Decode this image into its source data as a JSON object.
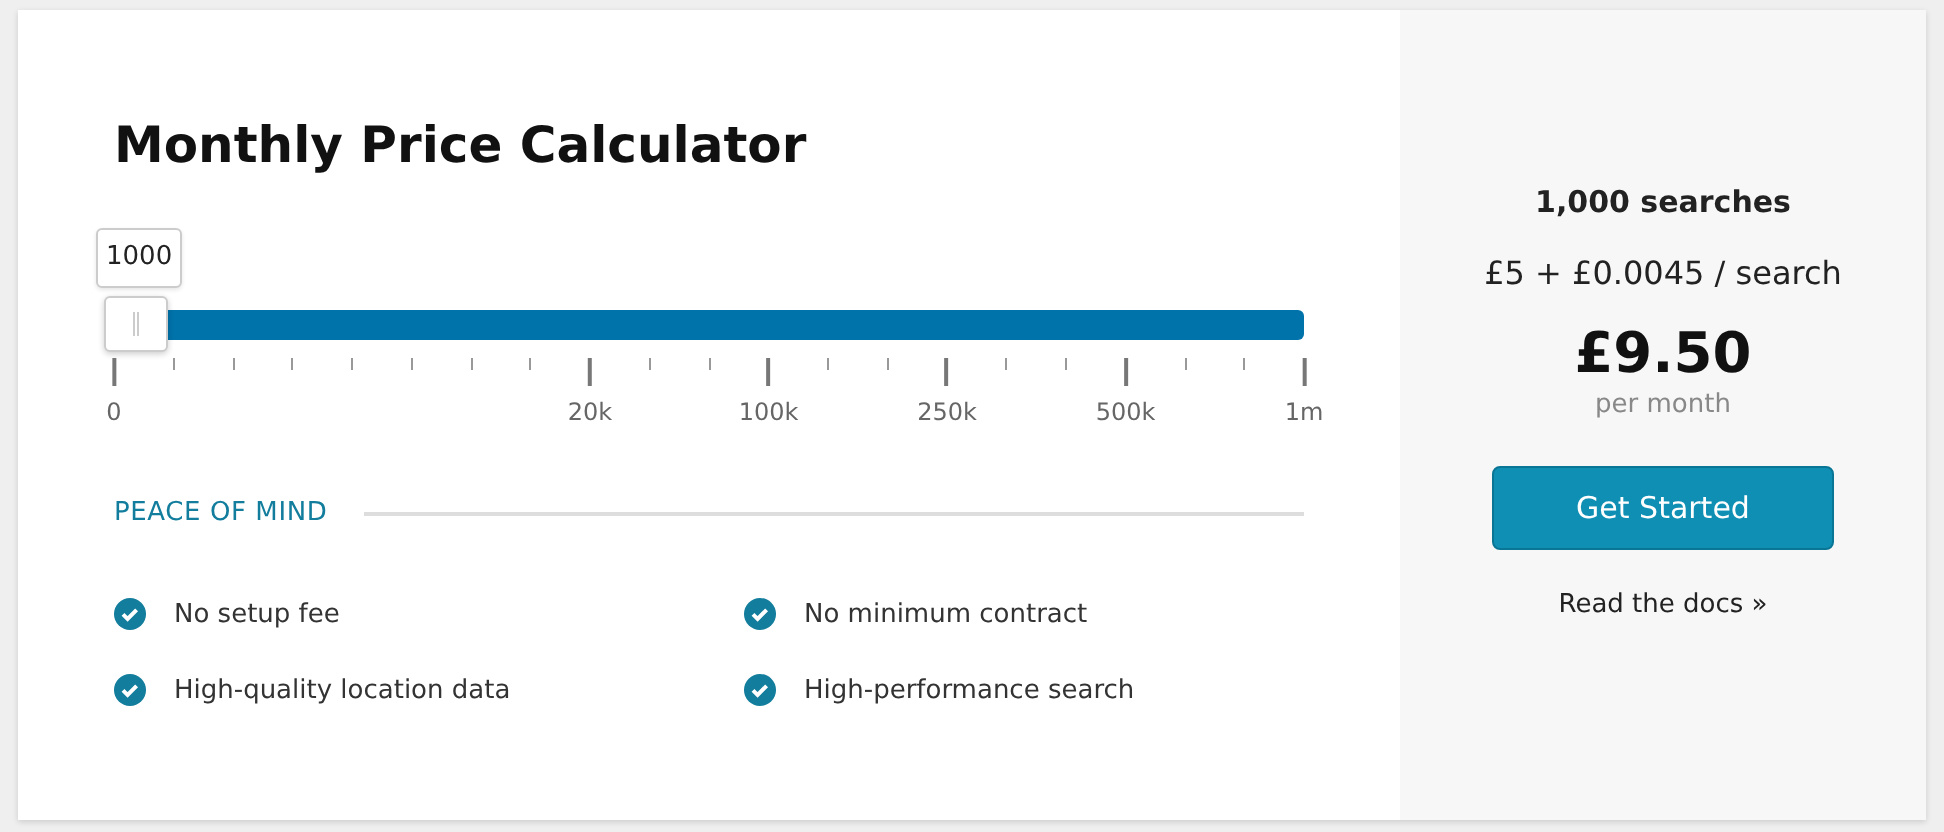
{
  "title": "Monthly Price Calculator",
  "slider": {
    "value": "1000",
    "level": 0.0,
    "ticks": [
      {
        "kind": "major",
        "label": "0"
      },
      {
        "kind": "minor"
      },
      {
        "kind": "minor"
      },
      {
        "kind": "minor"
      },
      {
        "kind": "minor"
      },
      {
        "kind": "minor"
      },
      {
        "kind": "minor"
      },
      {
        "kind": "minor"
      },
      {
        "kind": "major",
        "label": "20k"
      },
      {
        "kind": "minor"
      },
      {
        "kind": "minor"
      },
      {
        "kind": "major",
        "label": "100k"
      },
      {
        "kind": "minor"
      },
      {
        "kind": "minor"
      },
      {
        "kind": "major",
        "label": "250k"
      },
      {
        "kind": "minor"
      },
      {
        "kind": "minor"
      },
      {
        "kind": "major",
        "label": "500k"
      },
      {
        "kind": "minor"
      },
      {
        "kind": "minor"
      },
      {
        "kind": "major",
        "label": "1m"
      }
    ]
  },
  "section_heading": "PEACE OF MIND",
  "features": [
    {
      "label": "No setup fee"
    },
    {
      "label": "No minimum contract"
    },
    {
      "label": "High-quality location data"
    },
    {
      "label": "High-performance search"
    }
  ],
  "summary": {
    "searches": "1,000 searches",
    "formula": "£5 + £0.0045 / search",
    "price": "£9.50",
    "period": "per month",
    "button": "Get Started",
    "link": "Read the docs »"
  }
}
